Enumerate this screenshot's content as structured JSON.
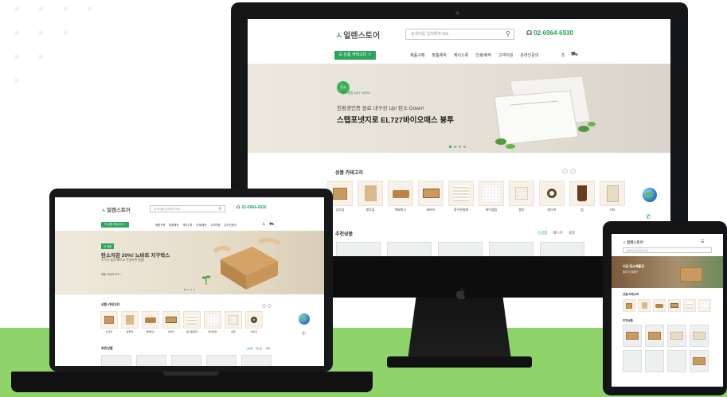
{
  "site": {
    "logo_mark": "ㅅ",
    "logo_text": "얼렌스토어",
    "search_placeholder": "검색어를 입력해주세요",
    "phone": "02-6964-6930",
    "category_button": "☰ 상품 카테고리 ∨",
    "nav": [
      "제품구매",
      "맞춤제작",
      "케이스류",
      "인쇄/제작",
      "고객지원",
      "온라인문의"
    ]
  },
  "desktop_hero": {
    "badge": "탄소중립 NET ZERO",
    "line1": "친환경인증 원료 내구성 Up! 탄소 Down!",
    "line2": "스탭포넷지로 EL727바이오매스 봉투"
  },
  "laptop_hero": {
    "badge": "신 제품",
    "line1": "탄소저감 20%! 노바트 지구박스",
    "line2": "누구나 쉽게 빠르고 안정하게 결합!",
    "link": "제품 자세히 보기 ›"
  },
  "sections": {
    "category_title": "상품 카테고리",
    "recommend_title": "추천상품",
    "recommend_tabs": [
      "신상품",
      "베스트",
      "세일"
    ]
  },
  "categories": [
    {
      "label": "상자류"
    },
    {
      "label": "봉투류"
    },
    {
      "label": "택배박스"
    },
    {
      "label": "싸바리"
    },
    {
      "label": "종이완충재"
    },
    {
      "label": "에어캡류"
    },
    {
      "label": "봉투"
    },
    {
      "label": "테이프"
    },
    {
      "label": "컵"
    },
    {
      "label": "기타"
    }
  ],
  "tablet_hero": {
    "line1": "지금 탄소배출권",
    "line2": "줄이기 캠페인"
  },
  "icons": {
    "apple": "apple-logo-icon",
    "search": "search-icon",
    "headset": "headset-icon",
    "user": "user-icon",
    "cart": "cart-icon",
    "globe": "globe-icon"
  },
  "colors": {
    "brand_green": "#2aa55b",
    "floor_green": "#8fd46b",
    "device_black": "#151617",
    "hero_beige": "#e7e2d8"
  }
}
